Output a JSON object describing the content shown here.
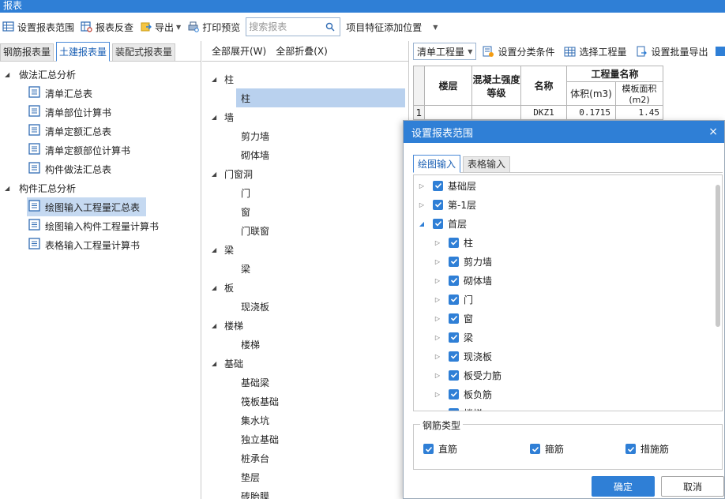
{
  "window": {
    "title": "报表"
  },
  "toolbar": {
    "set_range": "设置报表范围",
    "check": "报表反查",
    "export": "导出",
    "print_preview": "打印预览",
    "search_placeholder": "搜索报表",
    "add_feature": "项目特征添加位置"
  },
  "left": {
    "tabs": [
      "钢筋报表量",
      "土建报表量",
      "装配式报表量"
    ],
    "active_tab": 1,
    "groups": [
      {
        "label": "做法汇总分析",
        "items": [
          "清单汇总表",
          "清单部位计算书",
          "清单定额汇总表",
          "清单定额部位计算书",
          "构件做法汇总表"
        ]
      },
      {
        "label": "构件汇总分析",
        "items": [
          "绘图输入工程量汇总表",
          "绘图输入构件工程量计算书",
          "表格输入工程量计算书"
        ]
      }
    ],
    "selected_item": "绘图输入工程量汇总表"
  },
  "middle": {
    "expand_all": "全部展开(W)",
    "collapse_all": "全部折叠(X)",
    "groups": [
      {
        "label": "柱",
        "items": [
          "柱"
        ]
      },
      {
        "label": "墙",
        "items": [
          "剪力墙",
          "砌体墙"
        ]
      },
      {
        "label": "门窗洞",
        "items": [
          "门",
          "窗",
          "门联窗"
        ]
      },
      {
        "label": "梁",
        "items": [
          "梁"
        ]
      },
      {
        "label": "板",
        "items": [
          "现浇板"
        ]
      },
      {
        "label": "楼梯",
        "items": [
          "楼梯"
        ]
      },
      {
        "label": "基础",
        "items": [
          "基础梁",
          "筏板基础",
          "集水坑",
          "独立基础",
          "桩承台",
          "垫层",
          "砖胎膜"
        ]
      }
    ]
  },
  "right": {
    "select_value": "清单工程量",
    "set_category": "设置分类条件",
    "select_quantity": "选择工程量",
    "batch_export": "设置批量导出",
    "table": {
      "h_floor": "楼层",
      "h_concrete": "混凝土强度等级",
      "h_name": "名称",
      "h_quantity": "工程量名称",
      "h_volume": "体积(m3)",
      "h_formwork": "模板面积(m2)",
      "row_num": "1",
      "row_name": "DKZ1",
      "row_volume": "0.1715",
      "row_formwork": "1.45"
    }
  },
  "dialog": {
    "title": "设置报表范围",
    "close": "×",
    "tabs": [
      "绘图输入",
      "表格输入"
    ],
    "floors": [
      {
        "label": "基础层",
        "level": 0,
        "expanded": false
      },
      {
        "label": "第-1层",
        "level": 0,
        "expanded": false
      },
      {
        "label": "首层",
        "level": 0,
        "expanded": true
      },
      {
        "label": "柱",
        "level": 1,
        "expanded": false
      },
      {
        "label": "剪力墙",
        "level": 1,
        "expanded": false
      },
      {
        "label": "砌体墙",
        "level": 1,
        "expanded": false
      },
      {
        "label": "门",
        "level": 1,
        "expanded": false
      },
      {
        "label": "窗",
        "level": 1,
        "expanded": false
      },
      {
        "label": "梁",
        "level": 1,
        "expanded": false
      },
      {
        "label": "现浇板",
        "level": 1,
        "expanded": false
      },
      {
        "label": "板受力筋",
        "level": 1,
        "expanded": false
      },
      {
        "label": "板负筋",
        "level": 1,
        "expanded": false
      },
      {
        "label": "楼梯",
        "level": 1,
        "expanded": false
      }
    ],
    "rebar_legend": "钢筋类型",
    "rebar_options": [
      "直筋",
      "箍筋",
      "措施筋"
    ],
    "ok": "确定",
    "cancel": "取消"
  },
  "colors": {
    "accent": "#2f7fd6",
    "selected_bg": "#c5d9f1"
  }
}
